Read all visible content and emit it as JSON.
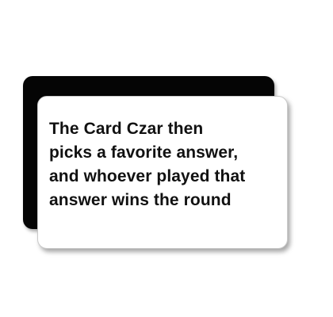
{
  "card": {
    "lines": [
      "The Card Czar then",
      "picks a favorite answer,",
      "and whoever played that",
      "answer wins the round"
    ]
  },
  "colors": {
    "back_card": "#050505",
    "front_card": "#ffffff",
    "text": "#111111"
  }
}
